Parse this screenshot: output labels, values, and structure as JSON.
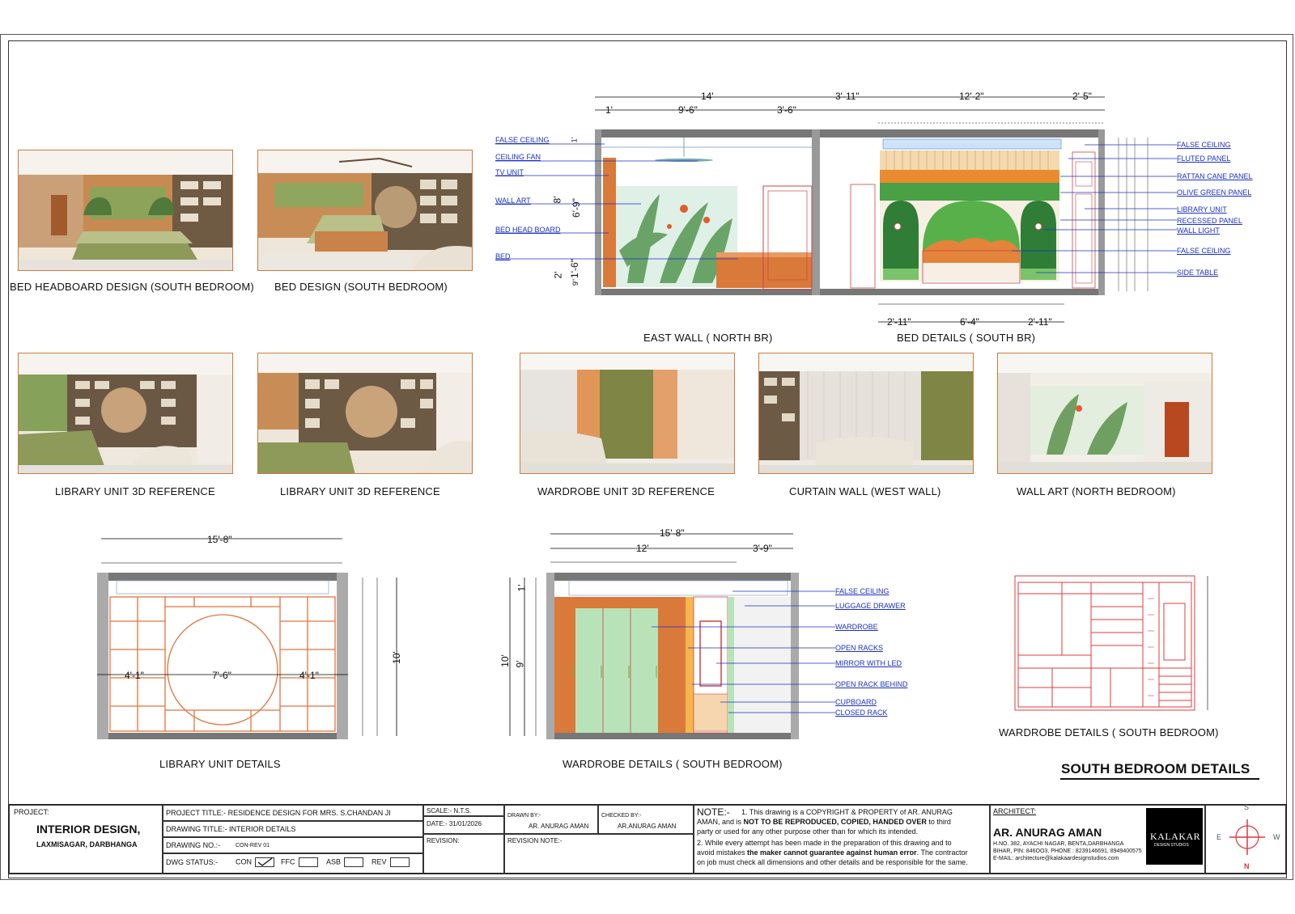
{
  "captions": {
    "bed_headboard": "BED HEADBOARD DESIGN (SOUTH BEDROOM)",
    "bed_design": "BED DESIGN (SOUTH BEDROOM)",
    "library_ref_1": "LIBRARY UNIT 3D REFERENCE",
    "library_ref_2": "LIBRARY UNIT 3D REFERENCE",
    "wardrobe_ref": "WARDROBE UNIT 3D REFERENCE",
    "curtain_wall": "CURTAIN WALL (WEST WALL)",
    "wall_art": "WALL ART (NORTH BEDROOM)",
    "east_wall": "EAST WALL ( NORTH BR)",
    "bed_details": "BED DETAILS ( SOUTH BR)",
    "library_details": "LIBRARY UNIT DETAILS",
    "wardrobe_details_1": "WARDROBE DETAILS ( SOUTH BEDROOM)",
    "wardrobe_details_2": "WARDROBE DETAILS ( SOUTH BEDROOM)",
    "sheet_title": "SOUTH BEDROOM DETAILS"
  },
  "east_wall": {
    "labels": [
      "FALSE CEILING",
      "CEILING FAN",
      "TV UNIT",
      "WALL ART",
      "BED HEAD BOARD",
      "BED"
    ],
    "dims_top": [
      "14'",
      "3'-11\"",
      "12'-2\"",
      "2'-5\""
    ],
    "dims_second": [
      "1'",
      "9'-6\"",
      "3'-6\""
    ],
    "dims_vertical": [
      "8'",
      "6'-9\"",
      "2'",
      "1'-6\"",
      "9\"",
      "1'"
    ]
  },
  "bed_details": {
    "labels": [
      "FALSE CEILING",
      "FLUTED PANEL",
      "RATTAN CANE PANEL",
      "OLIVE GREEN PANEL",
      "LIBRARY UNIT",
      "RECESSED PANEL",
      "WALL LIGHT",
      "FALSE CEILING",
      "SIDE TABLE"
    ],
    "dims_bottom": [
      "2'-11\"",
      "6'-4\"",
      "2'-11\""
    ]
  },
  "library_details": {
    "dim_total": "15'-8\"",
    "dims_middle": [
      "4'-1\"",
      "7'-6\"",
      "4'-1\""
    ],
    "dim_height": "10'"
  },
  "wardrobe_details": {
    "dim_total": "15'-8\"",
    "dims_second": [
      "12'",
      "3'-9\""
    ],
    "dims_vertical": [
      "10'",
      "9'",
      "1'"
    ],
    "labels": [
      "FALSE CEILING",
      "LUGGAGE DRAWER",
      "WARDROBE",
      "OPEN RACKS",
      "MIRROR WITH LED",
      "OPEN RACK BEHIND",
      "CUPBOARD",
      "CLOSED RACK"
    ]
  },
  "title_block": {
    "project_label": "PROJECT:",
    "project_name": "INTERIOR DESIGN,",
    "project_location": "LAXMISAGAR, DARBHANGA",
    "project_title": "PROJECT TITLE:- RESIDENCE DESIGN FOR MRS. S.CHANDAN JI",
    "drawing_title": "DRAWING TITLE:-  INTERIOR DETAILS",
    "drawing_no_label": "DRAWING NO.:-",
    "drawing_no": "CON-REV 01",
    "dwg_status_label": "DWG STATUS:-",
    "status_options": [
      "CON",
      "FFC",
      "ASB",
      "REV"
    ],
    "scale": "SCALE:- N.T.S.",
    "date": "DATE:-  31/01/2026",
    "revision": "REVISION:",
    "drawn_by_label": "DRAWN BY:-",
    "drawn_by": "AR. ANURAG AMAN",
    "checked_by_label": "CHECKED BY:-",
    "checked_by": "AR.ANURAG AMAN",
    "revision_note": "REVISION NOTE:-",
    "note_label": "NOTE:-",
    "note_1a": "1. This drawing is a COPYRIGHT & PROPERTY of AR. ANURAG",
    "note_1b": "AMAN, and is",
    "note_1c": "NOT TO BE REPRODUCED, COPIED, HANDED OVER",
    "note_1d": "to third",
    "note_1e": "party or used for any other purpose other than for which its intended.",
    "note_2a": "2. While every attempt has been made in the preparation of this drawing and to",
    "note_2b": "avoid mistakes",
    "note_2c": "the maker cannot guarantee against human error",
    "note_2d": ". The contractor",
    "note_2e": "on job must check all dimensions and other details and be responsible for the same.",
    "architect_label": "ARCHITECT:",
    "architect_name": "AR. ANURAG AMAN",
    "address_1": "H.NO. 382, AYACHI NAGAR, BENTA,DARBHANGA",
    "address_2": "BIHAR, PIN: 846OO3, PHONE  : 8239146691, 8949400575",
    "email": "E-MAIL:  architecture@kalakaardesignstudios.com",
    "logo_text": "KALAKAR",
    "logo_sub": "DESIGN STUDIOS",
    "compass": [
      "S",
      "E",
      "W",
      "N"
    ]
  },
  "colors": {
    "accent_red": "#e0353b",
    "brand_blue": "#1a2fc8",
    "wood": "#d9793a",
    "green": "#3a9a35"
  }
}
